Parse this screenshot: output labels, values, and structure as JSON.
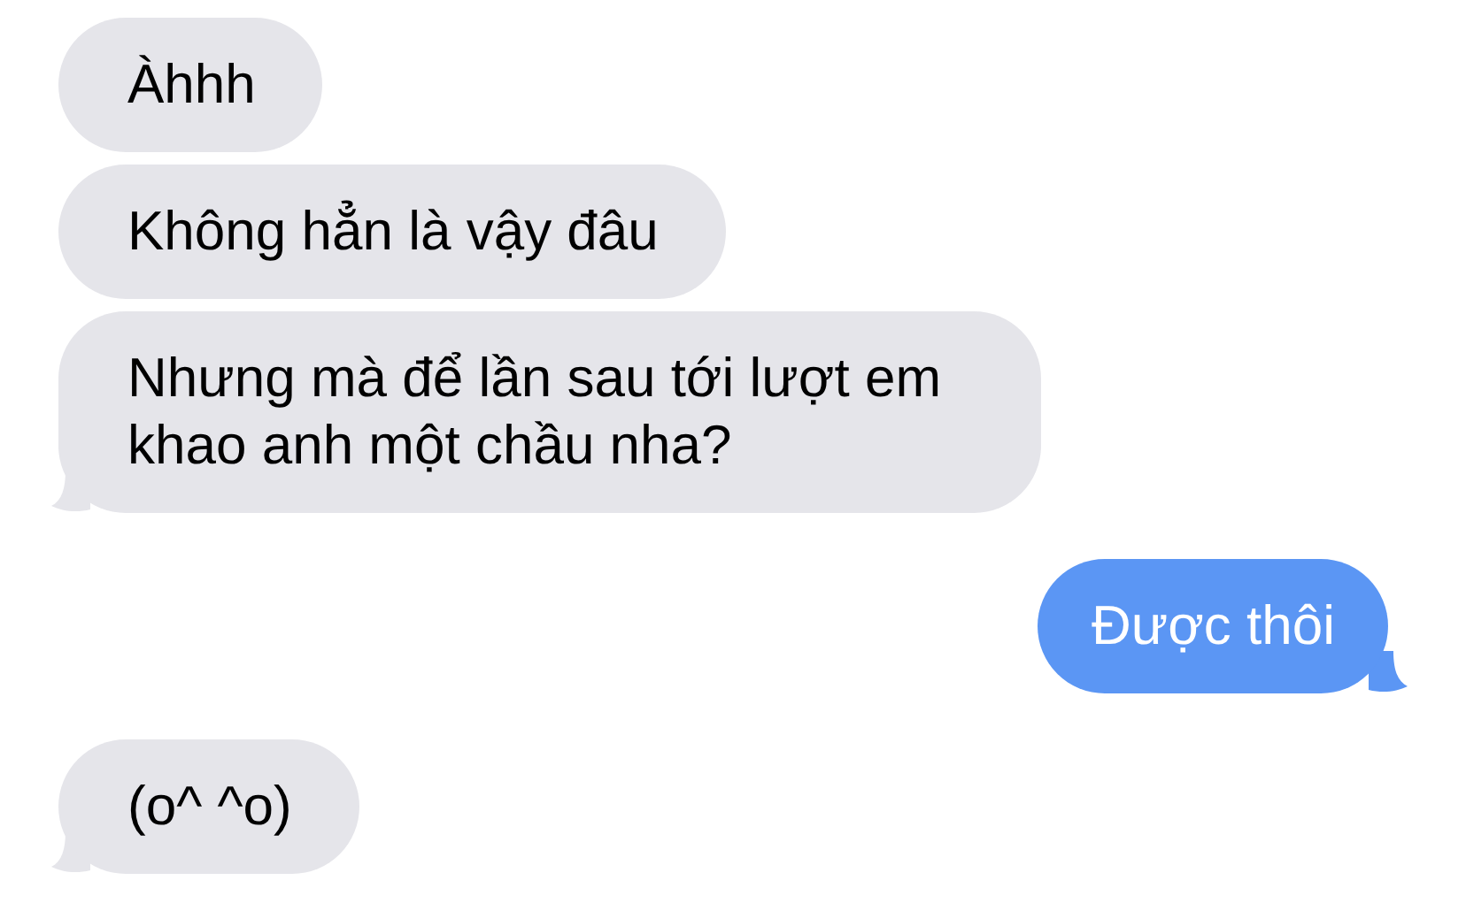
{
  "messages": [
    {
      "kind": "received",
      "text": "Àhhh",
      "tail": false
    },
    {
      "kind": "received",
      "text": "Không hẳn là vậy đâu",
      "tail": false
    },
    {
      "kind": "received",
      "text": "Nhưng mà để lần sau tới lượt em khao anh một chầu nha?",
      "tail": true
    },
    {
      "kind": "sent",
      "text": "Được thôi",
      "tail": true
    },
    {
      "kind": "received",
      "text": "(o^ ^o)",
      "tail": true
    }
  ]
}
